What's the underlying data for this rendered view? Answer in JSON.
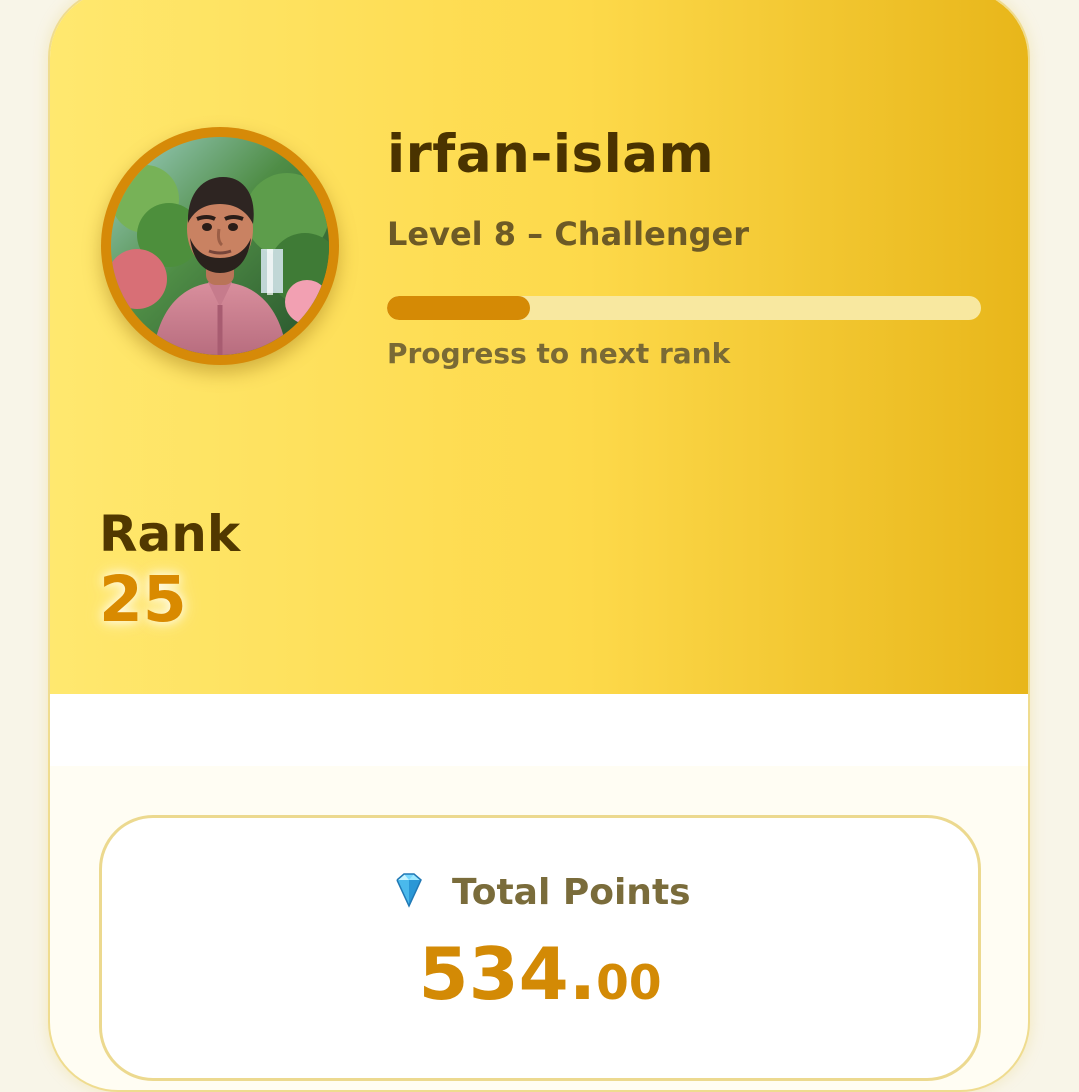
{
  "profile": {
    "username": "irfan-islam",
    "level_text": "Level 8 – Challenger",
    "progress_percent": 24,
    "progress_label": "Progress to next rank"
  },
  "rank": {
    "label": "Rank",
    "value": "25"
  },
  "points": {
    "title": "Total Points",
    "icon": "gem-icon",
    "whole": "534.",
    "decimal": "00"
  },
  "colors": {
    "accent": "#d58a05",
    "dark_text": "#4a3300",
    "muted_text": "#7a6a35",
    "gradient_start": "#ffe86f",
    "gradient_end": "#e8b61a"
  }
}
